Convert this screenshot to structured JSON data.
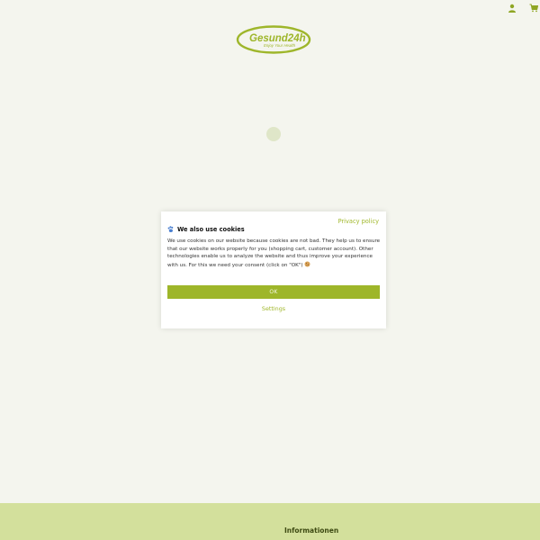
{
  "header": {
    "logo": {
      "brand": "Gesund24h",
      "tagline": "Enjoy Your Health"
    },
    "icons": {
      "account": "person-icon",
      "cart": "cart-icon"
    }
  },
  "loader": {
    "icon": "loading-spinner"
  },
  "cookie_dialog": {
    "privacy_link": "Privacy policy",
    "title": "We also use cookies",
    "title_icon": "paw-icon",
    "body": "We use cookies on our website because cookies are not bad. They help us to ensure that our website works properly for you (shopping cart, customer account). Other technologies enable us to analyze the website and thus improve your experience with us. For this we need your consent (click on \"OK\")",
    "body_icon": "cookie-icon",
    "ok_label": "OK",
    "settings_label": "Settings"
  },
  "footer": {
    "heading": "Informationen"
  },
  "colors": {
    "accent": "#9eb62a",
    "background": "#f4f5ee",
    "footer": "#d3e09c"
  }
}
